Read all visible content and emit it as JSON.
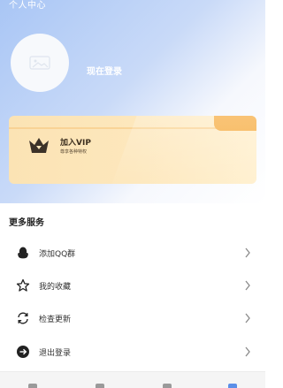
{
  "header": {
    "title": "个人中心"
  },
  "profile": {
    "login_text": "现在登录",
    "avatar_icon": "avatar-placeholder-icon"
  },
  "vip": {
    "title": "加入VIP",
    "subtitle": "尊享各种特权",
    "icon": "crown-icon",
    "accent": "#f7b24e"
  },
  "more_services": {
    "title": "更多服务",
    "items": [
      {
        "label": "添加QQ群",
        "icon": "qq-icon"
      },
      {
        "label": "我的收藏",
        "icon": "star-icon"
      },
      {
        "label": "检查更新",
        "icon": "refresh-icon"
      },
      {
        "label": "退出登录",
        "icon": "logout-icon"
      }
    ]
  },
  "colors": {
    "header_gradient_start": "#a9c6f5",
    "card_bg": "#fde7bc",
    "text_dark": "#222222"
  }
}
